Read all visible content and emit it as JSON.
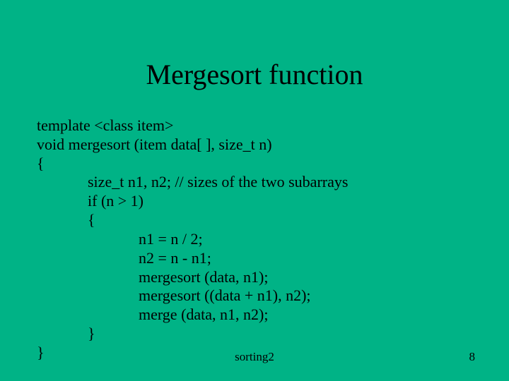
{
  "title": "Mergesort function",
  "code": {
    "l0": "template <class item>",
    "l1": "void mergesort (item data[ ], size_t n)",
    "l2": "{",
    "l3": "size_t n1, n2; // sizes of the two subarrays",
    "l4": "if (n > 1)",
    "l5": "{",
    "l6": "n1 = n / 2;",
    "l7": "n2 = n - n1;",
    "l8": "mergesort (data, n1);",
    "l9": "mergesort ((data + n1), n2);",
    "l10": "merge (data, n1, n2);",
    "l11": "}",
    "l12": "}"
  },
  "footer": {
    "label": "sorting2",
    "page": "8"
  }
}
